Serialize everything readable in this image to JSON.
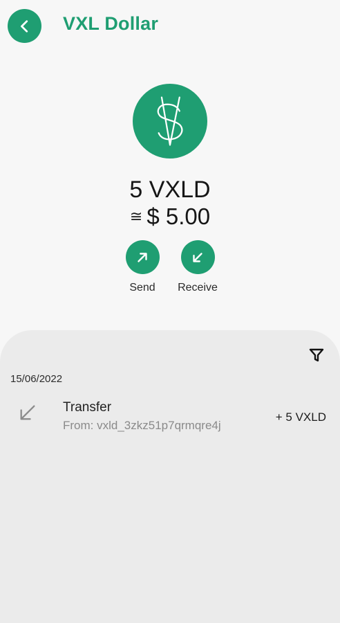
{
  "header": {
    "back_icon": "chevron-left-icon",
    "title": "VXL Dollar"
  },
  "token": {
    "logo_icon": "vxl-dollar-logo-icon",
    "balance": "5 VXLD",
    "fiat_approx_symbol": "≅",
    "fiat_value": "$ 5.00"
  },
  "actions": {
    "send_icon": "arrow-up-right-icon",
    "send_label": "Send",
    "receive_icon": "arrow-down-left-icon",
    "receive_label": "Receive"
  },
  "transactions": {
    "filter_icon": "filter-icon",
    "groups": [
      {
        "date": "15/06/2022",
        "items": [
          {
            "icon": "arrow-down-left-icon",
            "title": "Transfer",
            "from": "From: vxld_3zkz51p7qrmqre4j",
            "amount": "+ 5 VXLD"
          }
        ]
      }
    ]
  },
  "colors": {
    "accent": "#1f9e72",
    "background": "#f7f7f7",
    "sheet": "#ebebeb",
    "muted_text": "#8a8a8a"
  }
}
